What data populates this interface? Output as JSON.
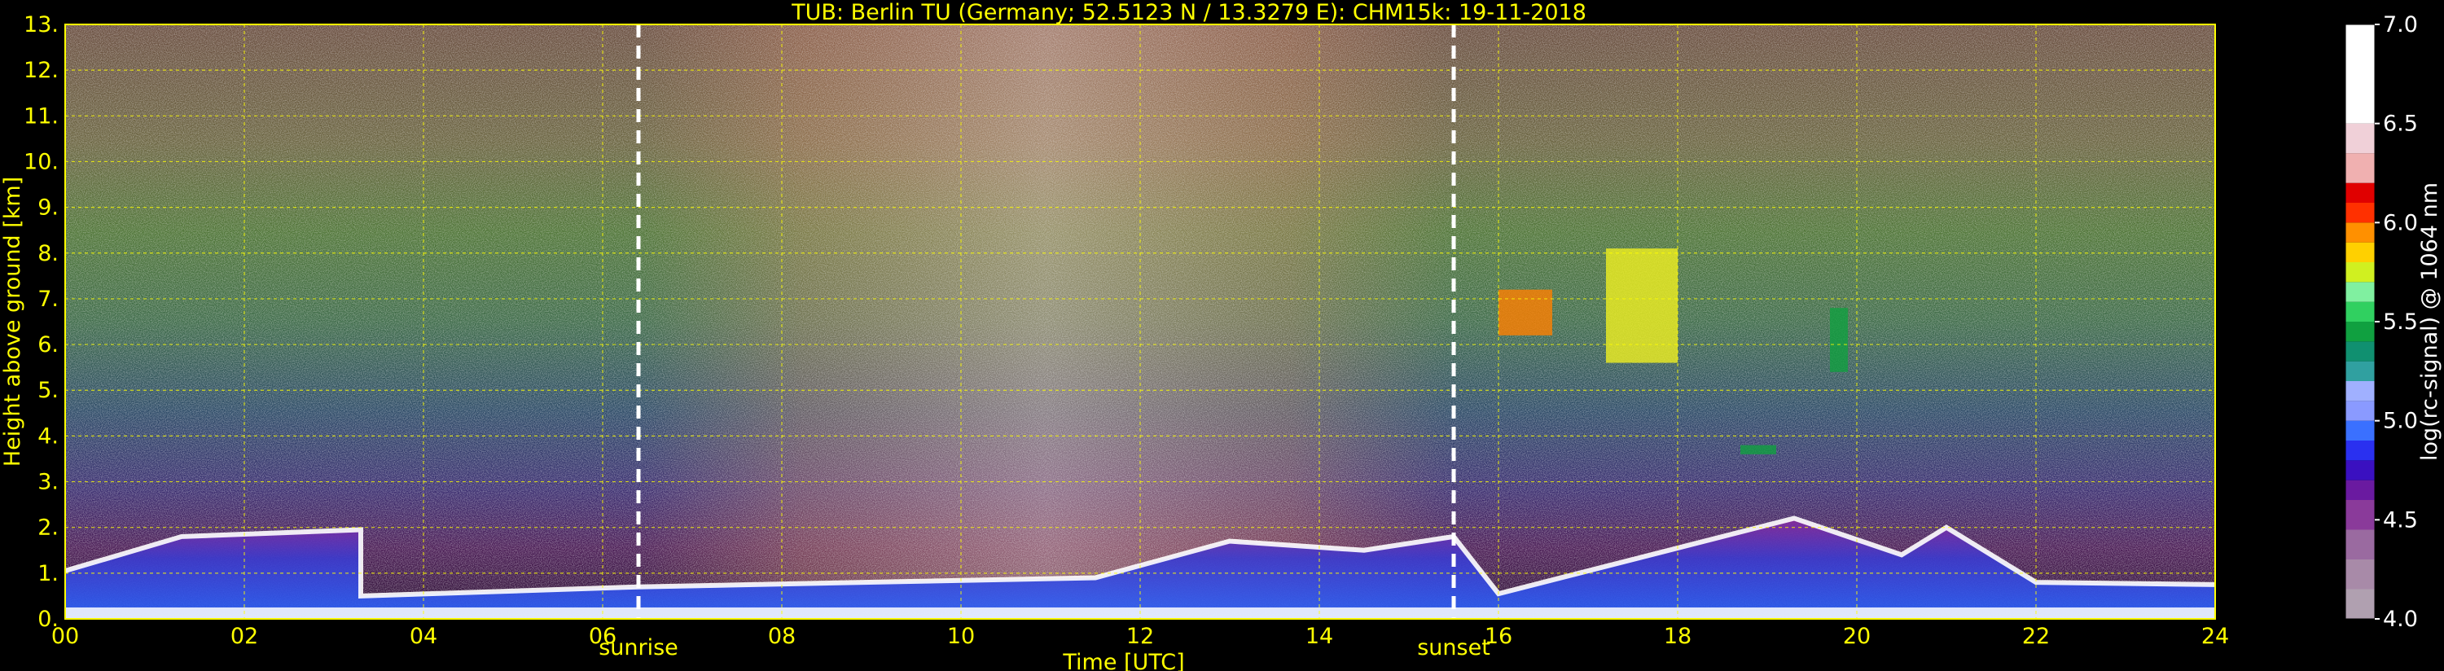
{
  "chart_data": {
    "type": "heatmap",
    "title": "TUB: Berlin TU (Germany; 52.5123 N / 13.3279 E):    CHM15k: 19-11-2018",
    "xlabel": "Time [UTC]",
    "ylabel": "Height above ground [km]",
    "xlim": [
      0,
      24
    ],
    "ylim": [
      0,
      13
    ],
    "x_ticks": [
      "00",
      "02",
      "04",
      "06",
      "08",
      "10",
      "12",
      "14",
      "16",
      "18",
      "20",
      "22",
      "24"
    ],
    "y_ticks": [
      "0.",
      "1.",
      "2.",
      "3.",
      "4.",
      "5.",
      "6.",
      "7.",
      "8.",
      "9.",
      "10.",
      "11.",
      "12.",
      "13."
    ],
    "grid": true,
    "events": [
      {
        "label": "sunrise",
        "x": 6.4
      },
      {
        "label": "sunset",
        "x": 15.5
      }
    ],
    "colorbar": {
      "label": "log(rc-signal) @ 1064 nm",
      "range": [
        4.0,
        7.0
      ],
      "ticks": [
        "4.0",
        "4.5",
        "5.0",
        "5.5",
        "6.0",
        "6.5",
        "7.0"
      ]
    },
    "boundary_layer_top_km": [
      {
        "x": 0.0,
        "y": 1.05
      },
      {
        "x": 1.3,
        "y": 1.8
      },
      {
        "x": 3.3,
        "y": 1.95
      },
      {
        "x": 3.3,
        "y": 0.5
      },
      {
        "x": 6.4,
        "y": 0.7
      },
      {
        "x": 11.5,
        "y": 0.9
      },
      {
        "x": 13.0,
        "y": 1.7
      },
      {
        "x": 14.5,
        "y": 1.5
      },
      {
        "x": 15.5,
        "y": 1.8
      },
      {
        "x": 16.0,
        "y": 0.55
      },
      {
        "x": 19.3,
        "y": 2.2
      },
      {
        "x": 20.5,
        "y": 1.4
      },
      {
        "x": 21.0,
        "y": 2.0
      },
      {
        "x": 22.0,
        "y": 0.8
      },
      {
        "x": 24.0,
        "y": 0.75
      }
    ],
    "cloud_features": [
      {
        "x": [
          16.0,
          16.6
        ],
        "y": [
          6.2,
          7.2
        ],
        "level": 6.0
      },
      {
        "x": [
          17.2,
          18.0
        ],
        "y": [
          5.6,
          8.1
        ],
        "level": 5.9
      },
      {
        "x": [
          18.7,
          19.1
        ],
        "y": [
          3.6,
          3.8
        ],
        "level": 5.4
      },
      {
        "x": [
          19.7,
          19.9
        ],
        "y": [
          5.4,
          6.8
        ],
        "level": 5.5
      }
    ]
  }
}
